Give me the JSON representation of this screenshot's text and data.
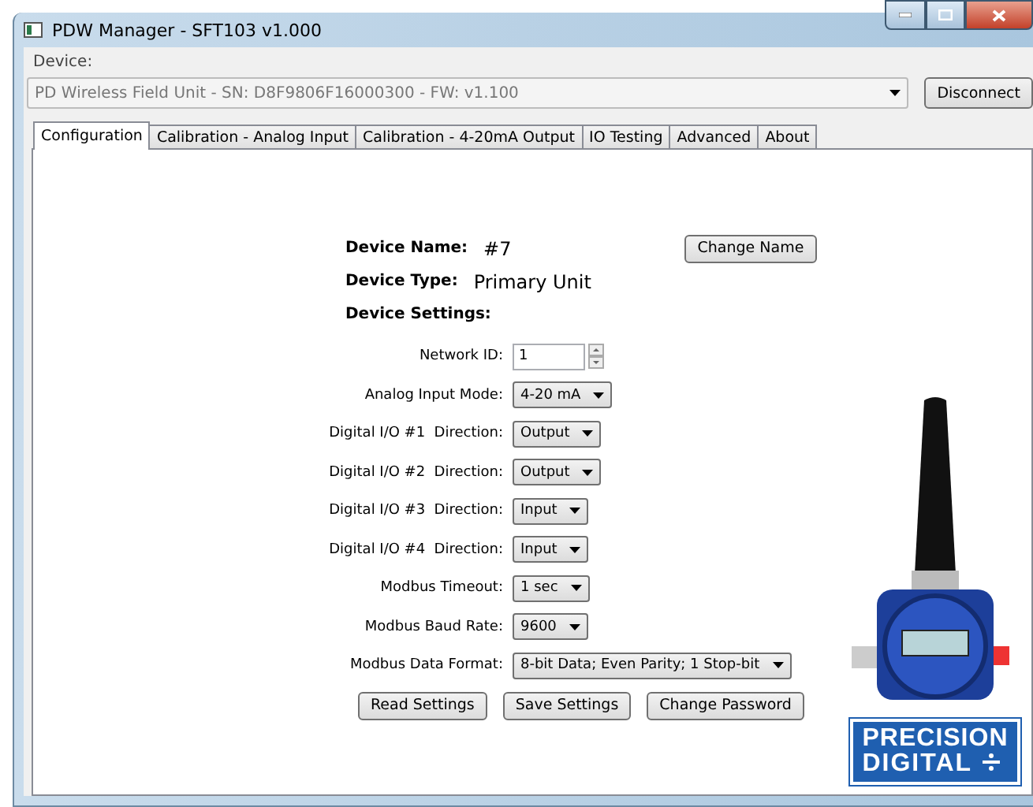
{
  "window": {
    "title": "PDW Manager - SFT103 v1.000"
  },
  "device": {
    "label": "Device:",
    "value": "PD Wireless Field Unit - SN: D8F9806F16000300 - FW: v1.100",
    "disconnect": "Disconnect"
  },
  "tabs": [
    {
      "label": "Configuration",
      "selected": true
    },
    {
      "label": "Calibration - Analog Input",
      "selected": false
    },
    {
      "label": "Calibration - 4-20mA Output",
      "selected": false
    },
    {
      "label": "IO Testing",
      "selected": false
    },
    {
      "label": "Advanced",
      "selected": false
    },
    {
      "label": "About",
      "selected": false
    }
  ],
  "config": {
    "name_label": "Device Name:",
    "name_value": "#7",
    "change_name": "Change Name",
    "type_label": "Device Type:",
    "type_value": "Primary Unit",
    "settings_heading": "Device Settings:",
    "settings": [
      {
        "kind": "spin",
        "label": "Network ID:",
        "value": "1"
      },
      {
        "kind": "select",
        "label": "Analog Input Mode:",
        "value": "4-20 mA"
      },
      {
        "kind": "select",
        "label": "Digital I/O #1  Direction:",
        "value": "Output"
      },
      {
        "kind": "select",
        "label": "Digital I/O #2  Direction:",
        "value": "Output"
      },
      {
        "kind": "select",
        "label": "Digital I/O #3  Direction:",
        "value": "Input"
      },
      {
        "kind": "select",
        "label": "Digital I/O #4  Direction:",
        "value": "Input"
      },
      {
        "kind": "select",
        "label": "Modbus Timeout:",
        "value": "1 sec"
      },
      {
        "kind": "select",
        "label": "Modbus Baud Rate:",
        "value": "9600"
      },
      {
        "kind": "select",
        "label": "Modbus Data Format:",
        "value": "8-bit Data; Even Parity; 1 Stop-bit"
      }
    ],
    "buttons": [
      "Read Settings",
      "Save Settings",
      "Change Password"
    ]
  },
  "logo": {
    "line1": "PRECISION",
    "line2": "DIGITAL"
  }
}
